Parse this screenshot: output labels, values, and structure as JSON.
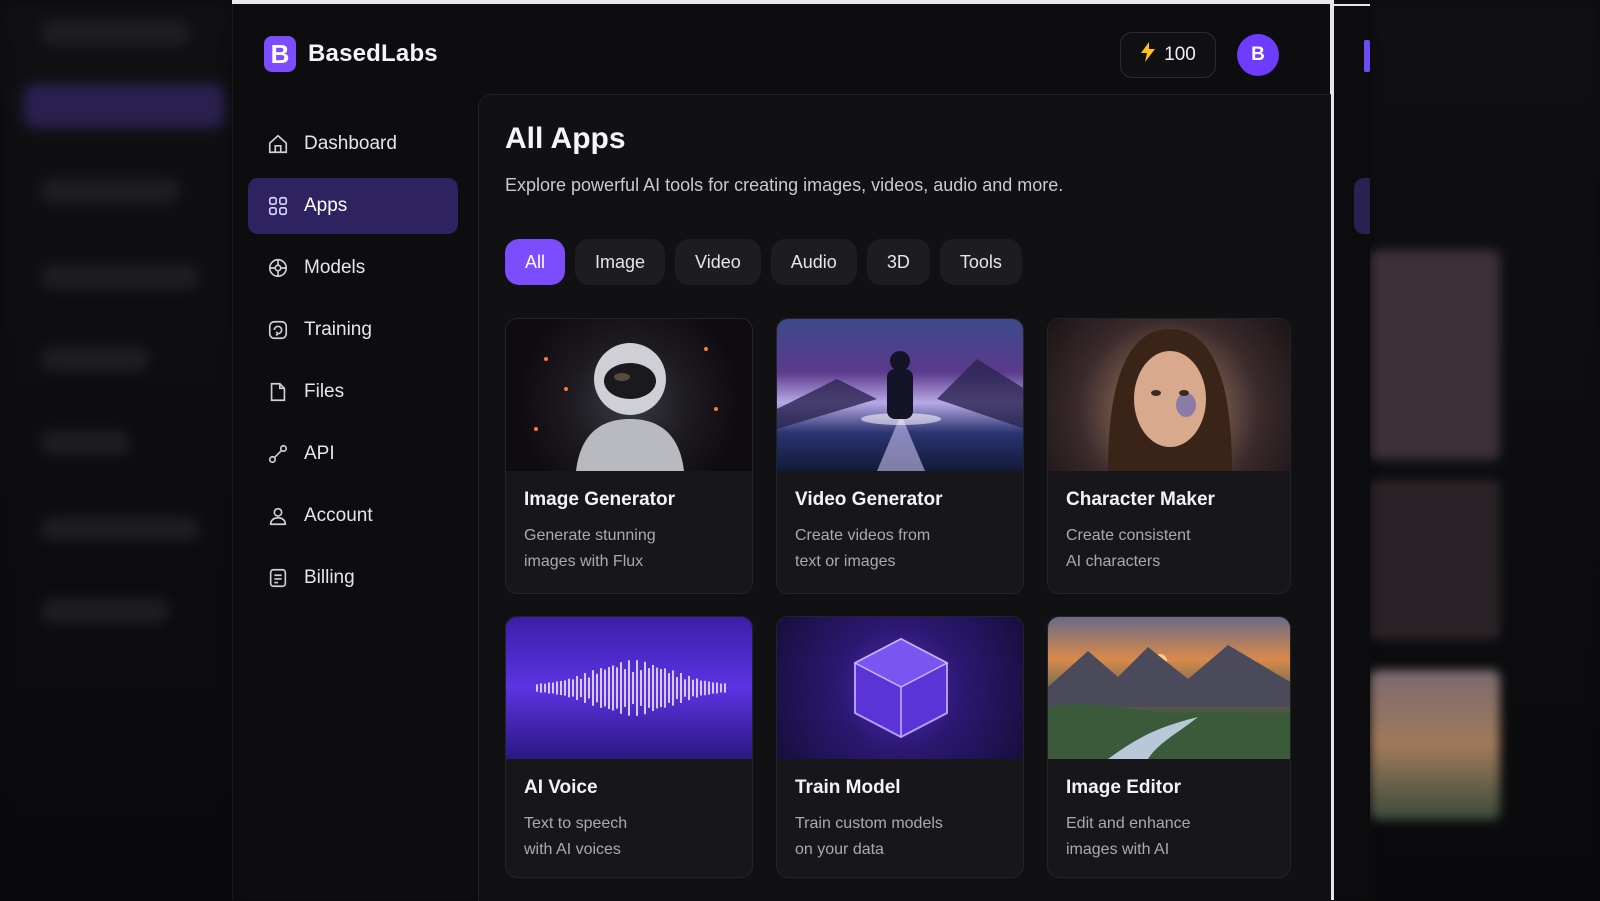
{
  "brand": {
    "name": "BasedLabs",
    "mark": "B"
  },
  "header": {
    "credits": "100",
    "avatar_initial": "B"
  },
  "sidebar": {
    "items": [
      {
        "label": "Dashboard",
        "icon": "home-icon",
        "active": false
      },
      {
        "label": "Apps",
        "icon": "apps-icon",
        "active": true
      },
      {
        "label": "Models",
        "icon": "models-icon",
        "active": false
      },
      {
        "label": "Training",
        "icon": "training-icon",
        "active": false
      },
      {
        "label": "Files",
        "icon": "file-icon",
        "active": false
      },
      {
        "label": "API",
        "icon": "link-icon",
        "active": false
      },
      {
        "label": "Account",
        "icon": "user-icon",
        "active": false
      },
      {
        "label": "Billing",
        "icon": "billing-icon",
        "active": false
      }
    ]
  },
  "main": {
    "title": "All Apps",
    "subtitle": "Explore powerful AI tools for creating images, videos, audio and more.",
    "filters": [
      {
        "label": "All",
        "active": true
      },
      {
        "label": "Image",
        "active": false
      },
      {
        "label": "Video",
        "active": false
      },
      {
        "label": "Audio",
        "active": false
      },
      {
        "label": "3D",
        "active": false
      },
      {
        "label": "Tools",
        "active": false
      }
    ],
    "apps": [
      {
        "title": "Image Generator",
        "desc_line1": "Generate stunning",
        "desc_line2": "images with Flux",
        "thumb": "astronaut-image"
      },
      {
        "title": "Video Generator",
        "desc_line1": "Create videos from",
        "desc_line2": "text or images",
        "thumb": "figure-on-road-image"
      },
      {
        "title": "Character Maker",
        "desc_line1": "Create consistent",
        "desc_line2": "AI characters",
        "thumb": "portrait-image"
      },
      {
        "title": "AI Voice",
        "desc_line1": "Text to speech",
        "desc_line2": "with AI voices",
        "thumb": "waveform-image"
      },
      {
        "title": "Train Model",
        "desc_line1": "Train custom models",
        "desc_line2": "on your data",
        "thumb": "cube-image"
      },
      {
        "title": "Image Editor",
        "desc_line1": "Edit and enhance",
        "desc_line2": "images with AI",
        "thumb": "landscape-image"
      }
    ]
  },
  "colors": {
    "accent": "#7c4dff",
    "active_nav": "#2e2360",
    "credit_bolt": "#ffc21a",
    "background": "#0d0d0f"
  }
}
